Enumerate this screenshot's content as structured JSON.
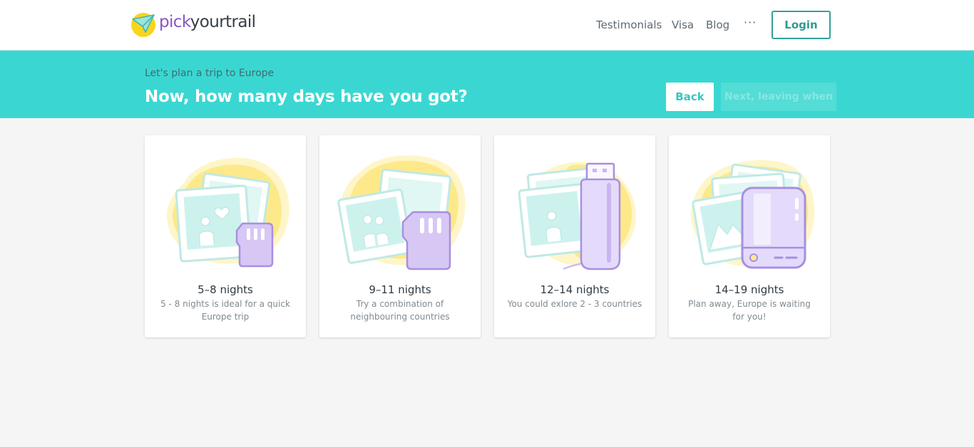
{
  "header": {
    "brand_pick": "pick",
    "brand_rest": "yourtrail",
    "nav": [
      "Testimonials",
      "Visa",
      "Blog"
    ],
    "more": "···",
    "login": "Login"
  },
  "banner": {
    "subtitle": "Let's plan a trip to Europe",
    "title": "Now, how many days have you got?",
    "back": "Back",
    "next": "Next, leaving when"
  },
  "cards": [
    {
      "title": "5–8 nights",
      "desc": "5 - 8 nights is ideal for a quick Europe trip",
      "icon": "sd-card-photos-illustration"
    },
    {
      "title": "9–11 nights",
      "desc": "Try a combination of neighbouring countries",
      "icon": "sd-card-couple-photos-illustration"
    },
    {
      "title": "12–14 nights",
      "desc": "You could exlore 2 - 3 countries",
      "icon": "usb-drive-photos-illustration"
    },
    {
      "title": "14–19 nights",
      "desc": "Plan away, Europe is waiting for you!",
      "icon": "hard-drive-photos-illustration"
    }
  ],
  "colors": {
    "banner": "#3ad7d2",
    "brand_purple": "#8b55c9",
    "login_border": "#2ea39a",
    "blob_yellow": "#fde98a",
    "device_purple": "#c9b6f1",
    "photo_mint": "#cdf2ee"
  }
}
